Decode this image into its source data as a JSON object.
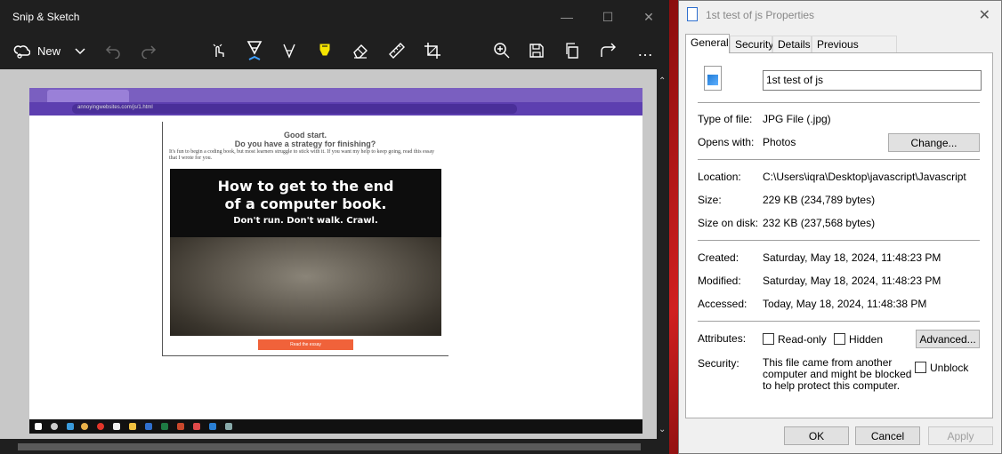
{
  "snip": {
    "title": "Snip & Sketch",
    "new_label": "New",
    "screenshot": {
      "url": "annoyingwebsites.com/js/1.html",
      "heading1": "Good start.",
      "heading2": "Do you have a strategy for finishing?",
      "paragraph": "It's fun to begin a coding book, but most learners struggle to stick with it. If you want my help to keep going, read this essay that I wrote for you.",
      "banner_title1": "How to get to the end",
      "banner_title2": "of a computer book.",
      "banner_subtitle": "Don't run. Don't walk. Crawl.",
      "button_label": "Read the essay"
    }
  },
  "props": {
    "title": "1st test of js Properties",
    "tabs": [
      "General",
      "Security",
      "Details",
      "Previous Versions"
    ],
    "file_name": "1st test of js",
    "type_label": "Type of file:",
    "type_value": "JPG File (.jpg)",
    "opens_label": "Opens with:",
    "opens_value": "Photos",
    "change_label": "Change...",
    "location_label": "Location:",
    "location_value": "C:\\Users\\iqra\\Desktop\\javascript\\Javascript",
    "size_label": "Size:",
    "size_value": "229 KB (234,789 bytes)",
    "disk_label": "Size on disk:",
    "disk_value": "232 KB (237,568 bytes)",
    "created_label": "Created:",
    "created_value": "Saturday, May 18, 2024, 11:48:23 PM",
    "modified_label": "Modified:",
    "modified_value": "Saturday, May 18, 2024, 11:48:23 PM",
    "accessed_label": "Accessed:",
    "accessed_value": "Today, May 18, 2024, 11:48:38 PM",
    "attributes_label": "Attributes:",
    "readonly_label": "Read-only",
    "hidden_label": "Hidden",
    "advanced_label": "Advanced...",
    "security_label": "Security:",
    "security_text": "This file came from another computer and might be blocked to help protect this computer.",
    "unblock_label": "Unblock",
    "ok_label": "OK",
    "cancel_label": "Cancel",
    "apply_label": "Apply"
  }
}
